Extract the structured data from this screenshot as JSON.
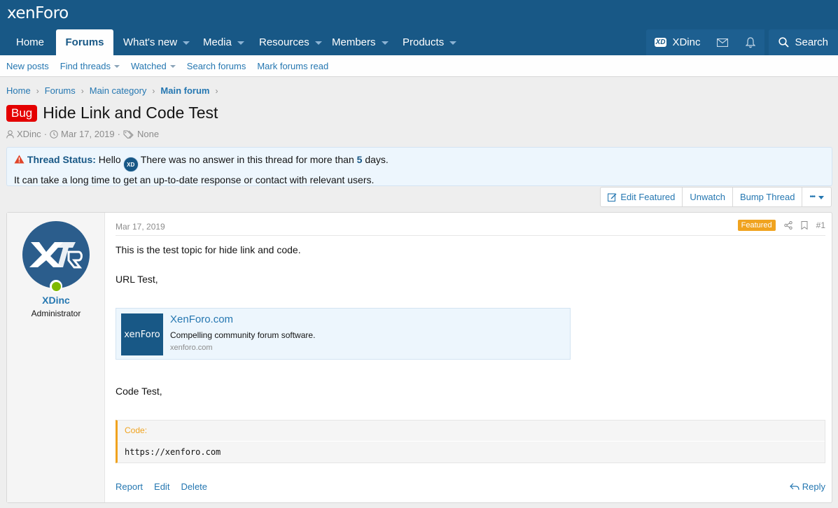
{
  "header": {
    "logo": "xenForo"
  },
  "nav": {
    "tabs": [
      {
        "label": "Home"
      },
      {
        "label": "Forums"
      },
      {
        "label": "What's new"
      },
      {
        "label": "Media"
      },
      {
        "label": "Resources"
      },
      {
        "label": "Members"
      },
      {
        "label": "Products"
      }
    ],
    "user": "XDinc",
    "search": "Search"
  },
  "subnav": {
    "items": [
      "New posts",
      "Find threads",
      "Watched",
      "Search forums",
      "Mark forums read"
    ]
  },
  "breadcrumb": [
    "Home",
    "Forums",
    "Main category",
    "Main forum"
  ],
  "thread": {
    "prefix": "Bug",
    "title": "Hide Link and Code Test",
    "author": "XDinc",
    "date": "Mar 17, 2019",
    "tags": "None"
  },
  "notice": {
    "status_label": "Thread Status:",
    "hello": "Hello",
    "text1": "There was no answer in this thread for more than",
    "days_num": "5",
    "days_word": "days.",
    "text2": "It can take a long time to get an up-to-date response or contact with relevant users."
  },
  "thread_buttons": {
    "edit_featured": "Edit Featured",
    "unwatch": "Unwatch",
    "bump": "Bump Thread",
    "more": "•••"
  },
  "post": {
    "username": "XDinc",
    "usertitle": "Administrator",
    "date": "Mar 17, 2019",
    "featured": "Featured",
    "number": "#1",
    "line1": "This is the test topic for hide link and code.",
    "line2": "URL Test,",
    "unfurl": {
      "logo": "xenForo",
      "title": "XenForo.com",
      "desc": "Compelling community forum software.",
      "domain": "xenforo.com"
    },
    "line3": "Code Test,",
    "code_label": "Code:",
    "code": "https://xenforo.com",
    "actions": [
      "Report",
      "Edit",
      "Delete"
    ],
    "reply": "Reply"
  },
  "colors": {
    "brand": "#185886",
    "link": "#2577b1",
    "bug": "#e40000",
    "featured": "#f0a31f",
    "online": "#7fb900"
  }
}
